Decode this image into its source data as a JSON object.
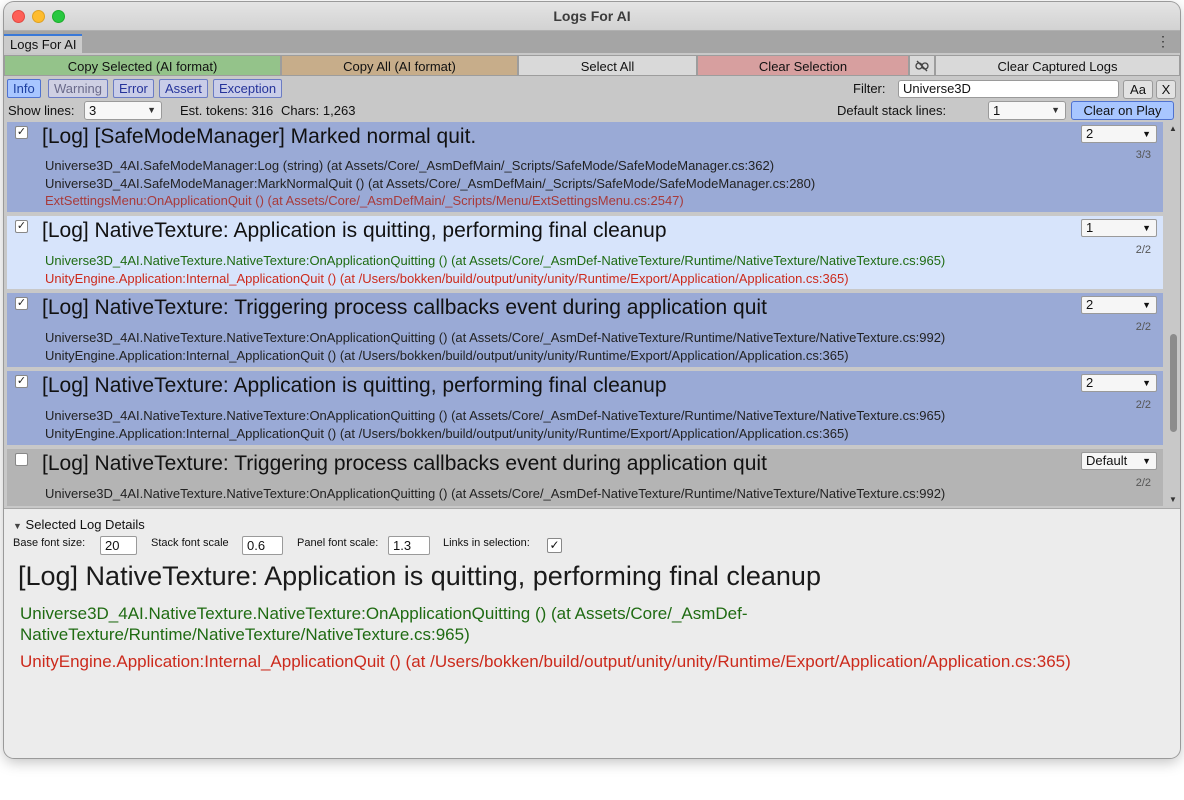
{
  "window": {
    "title": "Logs For AI"
  },
  "tab": {
    "label": "Logs For AI",
    "menu_icon": "kebab-menu-icon"
  },
  "toolbar": {
    "copy_selected": "Copy Selected (AI format)",
    "copy_all": "Copy All (AI format)",
    "select_all": "Select All",
    "clear_selection": "Clear Selection",
    "unlink_icon": "unlink-icon",
    "clear_captured": "Clear Captured Logs",
    "colors": {
      "copy_selected": "#94c38a",
      "copy_all": "#c7ad8a",
      "select_all": "#d9d9d9",
      "clear_selection": "#d79f9f",
      "clear_captured": "#d9d9d9"
    }
  },
  "levels": {
    "info": "Info",
    "warning": "Warning",
    "error": "Error",
    "assert": "Assert",
    "exception": "Exception"
  },
  "filter": {
    "label": "Filter:",
    "value": "Universe3D",
    "case_button": "Aa",
    "clear_button": "X"
  },
  "stats": {
    "show_lines_label": "Show lines:",
    "show_lines_value": "3",
    "tokens": "Est. tokens: 316",
    "chars": "Chars: 1,263",
    "default_stack_label": "Default stack lines:",
    "default_stack_value": "1",
    "clear_on_play": "Clear on Play"
  },
  "logs": [
    {
      "checked": true,
      "title": "[Log] [SafeModeManager] Marked normal quit.",
      "stack_lines_value": "2",
      "count": "3/3",
      "lines": [
        {
          "text": "Universe3D_4AI.SafeModeManager:Log (string) (at Assets/Core/_AsmDefMain/_Scripts/SafeMode/SafeModeManager.cs:362)",
          "color": "dark"
        },
        {
          "text": "Universe3D_4AI.SafeModeManager:MarkNormalQuit () (at Assets/Core/_AsmDefMain/_Scripts/SafeMode/SafeModeManager.cs:280)",
          "color": "dark"
        },
        {
          "text": "ExtSettingsMenu:OnApplicationQuit () (at Assets/Core/_AsmDefMain/_Scripts/Menu/ExtSettingsMenu.cs:2547)",
          "color": "maroon"
        }
      ],
      "bg": "#9aaad6"
    },
    {
      "checked": true,
      "title": "[Log] NativeTexture: Application is quitting, performing final cleanup",
      "stack_lines_value": "1",
      "count": "2/2",
      "lines": [
        {
          "text": "Universe3D_4AI.NativeTexture.NativeTexture:OnApplicationQuitting () (at Assets/Core/_AsmDef-NativeTexture/Runtime/NativeTexture/NativeTexture.cs:965)",
          "color": "green"
        },
        {
          "text": "UnityEngine.Application:Internal_ApplicationQuit () (at /Users/bokken/build/output/unity/unity/Runtime/Export/Application/Application.cs:365)",
          "color": "red"
        }
      ],
      "bg": "#d7e4fb"
    },
    {
      "checked": true,
      "title": "[Log] NativeTexture: Triggering process callbacks event during application quit",
      "stack_lines_value": "2",
      "count": "2/2",
      "lines": [
        {
          "text": "Universe3D_4AI.NativeTexture.NativeTexture:OnApplicationQuitting () (at Assets/Core/_AsmDef-NativeTexture/Runtime/NativeTexture/NativeTexture.cs:992)",
          "color": "dark"
        },
        {
          "text": "UnityEngine.Application:Internal_ApplicationQuit () (at /Users/bokken/build/output/unity/unity/Runtime/Export/Application/Application.cs:365)",
          "color": "dark"
        }
      ],
      "bg": "#9aaad6"
    },
    {
      "checked": true,
      "title": "[Log] NativeTexture: Application is quitting, performing final cleanup",
      "stack_lines_value": "2",
      "count": "2/2",
      "lines": [
        {
          "text": "Universe3D_4AI.NativeTexture.NativeTexture:OnApplicationQuitting () (at Assets/Core/_AsmDef-NativeTexture/Runtime/NativeTexture/NativeTexture.cs:965)",
          "color": "dark"
        },
        {
          "text": "UnityEngine.Application:Internal_ApplicationQuit () (at /Users/bokken/build/output/unity/unity/Runtime/Export/Application/Application.cs:365)",
          "color": "dark"
        }
      ],
      "bg": "#9aaad6"
    },
    {
      "checked": false,
      "title": "[Log] NativeTexture: Triggering process callbacks event during application quit",
      "stack_lines_value": "Default",
      "count": "2/2",
      "lines": [
        {
          "text": "Universe3D_4AI.NativeTexture.NativeTexture:OnApplicationQuitting () (at Assets/Core/_AsmDef-NativeTexture/Runtime/NativeTexture/NativeTexture.cs:992)",
          "color": "dark"
        }
      ],
      "bg": "#b4b4b4"
    }
  ],
  "details": {
    "header": "Selected Log Details",
    "base_font_label": "Base font size:",
    "base_font_value": "20",
    "stack_scale_label": "Stack font scale",
    "stack_scale_value": "0.6",
    "panel_scale_label": "Panel font scale:",
    "panel_scale_value": "1.3",
    "links_label": "Links in selection:",
    "links_checked": true,
    "title": "[Log] NativeTexture: Application is quitting, performing final cleanup",
    "line1": "Universe3D_4AI.NativeTexture.NativeTexture:OnApplicationQuitting () (at Assets/Core/_AsmDef-NativeTexture/Runtime/NativeTexture/NativeTexture.cs:965)",
    "line2": "UnityEngine.Application:Internal_ApplicationQuit () (at /Users/bokken/build/output/unity/unity/Runtime/Export/Application/Application.cs:365)"
  }
}
